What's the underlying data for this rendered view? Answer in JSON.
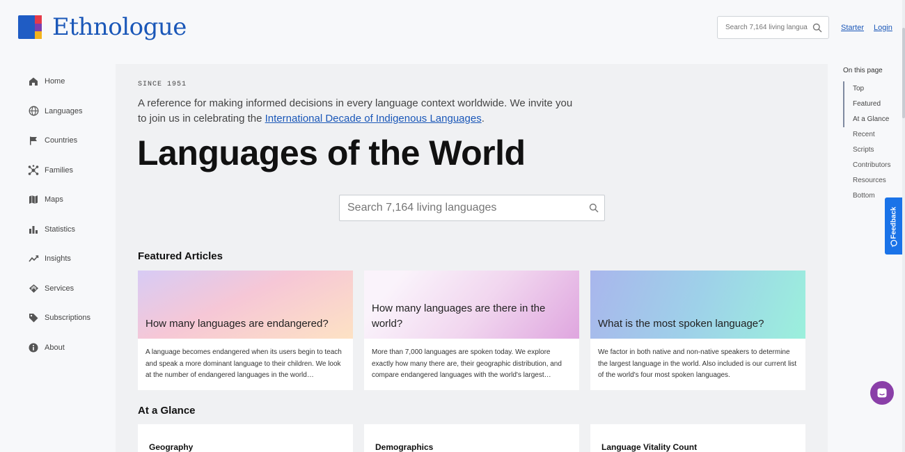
{
  "header": {
    "logo_text": "Ethnologue",
    "search_placeholder": "Search 7,164 living langua",
    "starter_label": "Starter",
    "login_label": "Login"
  },
  "sidebar": {
    "items": [
      {
        "label": "Home",
        "icon": "home-icon"
      },
      {
        "label": "Languages",
        "icon": "globe-icon"
      },
      {
        "label": "Countries",
        "icon": "flag-icon"
      },
      {
        "label": "Families",
        "icon": "network-icon"
      },
      {
        "label": "Maps",
        "icon": "map-icon"
      },
      {
        "label": "Statistics",
        "icon": "bar-chart-icon"
      },
      {
        "label": "Insights",
        "icon": "trend-icon"
      },
      {
        "label": "Services",
        "icon": "services-icon"
      },
      {
        "label": "Subscriptions",
        "icon": "tag-icon"
      },
      {
        "label": "About",
        "icon": "info-icon"
      }
    ]
  },
  "main": {
    "since": "SINCE 1951",
    "intro_text": "A reference for making informed decisions in every language context worldwide. We invite you to join us in celebrating the ",
    "intro_link": "International Decade of Indigenous Languages",
    "intro_end": ".",
    "title": "Languages of the World",
    "search_placeholder": "Search 7,164 living languages",
    "featured_title": "Featured Articles",
    "featured": [
      {
        "title": "How many languages are endangered?",
        "desc": "A language becomes endangered when its users begin to teach and speak a more dominant language to their children. We look at the number of endangered languages in the world…"
      },
      {
        "title": "How many languages are there in the world?",
        "desc": "More than 7,000 languages are spoken today. We explore exactly how many there are, their geographic distribution, and compare endangered languages with the world's largest…"
      },
      {
        "title": "What is the most spoken language?",
        "desc": "We factor in both native and non-native speakers to determine the largest language in the world. Also included is our current list of the world's four most spoken languages."
      }
    ],
    "glance_title": "At a Glance",
    "glance": [
      {
        "title": "Geography"
      },
      {
        "title": "Demographics"
      },
      {
        "title": "Language Vitality Count"
      }
    ]
  },
  "on_this_page": {
    "title": "On this page",
    "items": [
      "Top",
      "Featured",
      "At a Glance",
      "Recent",
      "Scripts",
      "Contributors",
      "Resources",
      "Bottom"
    ]
  },
  "feedback_label": "Feedback",
  "colors": {
    "brand_blue": "#1a57b8",
    "feedback_blue": "#1a73e8",
    "chat_purple": "#8a3fa8"
  }
}
